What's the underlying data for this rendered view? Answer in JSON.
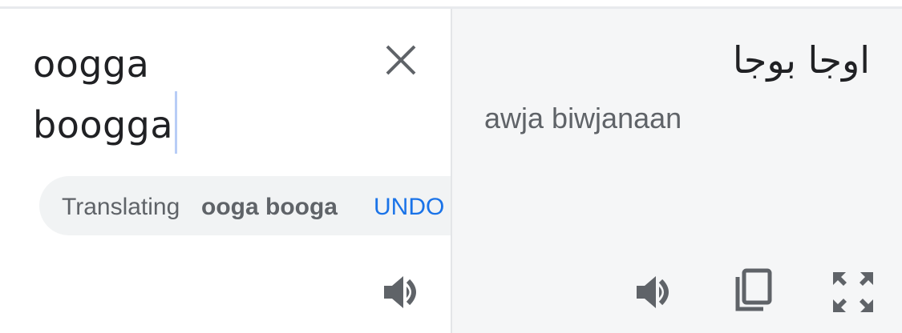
{
  "source": {
    "text_line_1": "oogga",
    "text_line_2": "boogga",
    "clear_icon": "close-icon",
    "listen_icon": "speaker-icon"
  },
  "suggestion": {
    "prefix": "Translating",
    "term": "ooga booga",
    "undo_label": "UNDO"
  },
  "target": {
    "translation": "اوجا بوجا",
    "romanization": "awja biwjanaan",
    "listen_icon": "speaker-icon",
    "copy_icon": "copy-icon",
    "fullscreen_icon": "fullscreen-icon"
  },
  "colors": {
    "text_primary": "#202124",
    "text_secondary": "#5f6368",
    "link_blue": "#1a73e8",
    "target_background": "#f5f6f7",
    "chip_background": "#f1f3f4",
    "caret": "#b8cdf6"
  }
}
